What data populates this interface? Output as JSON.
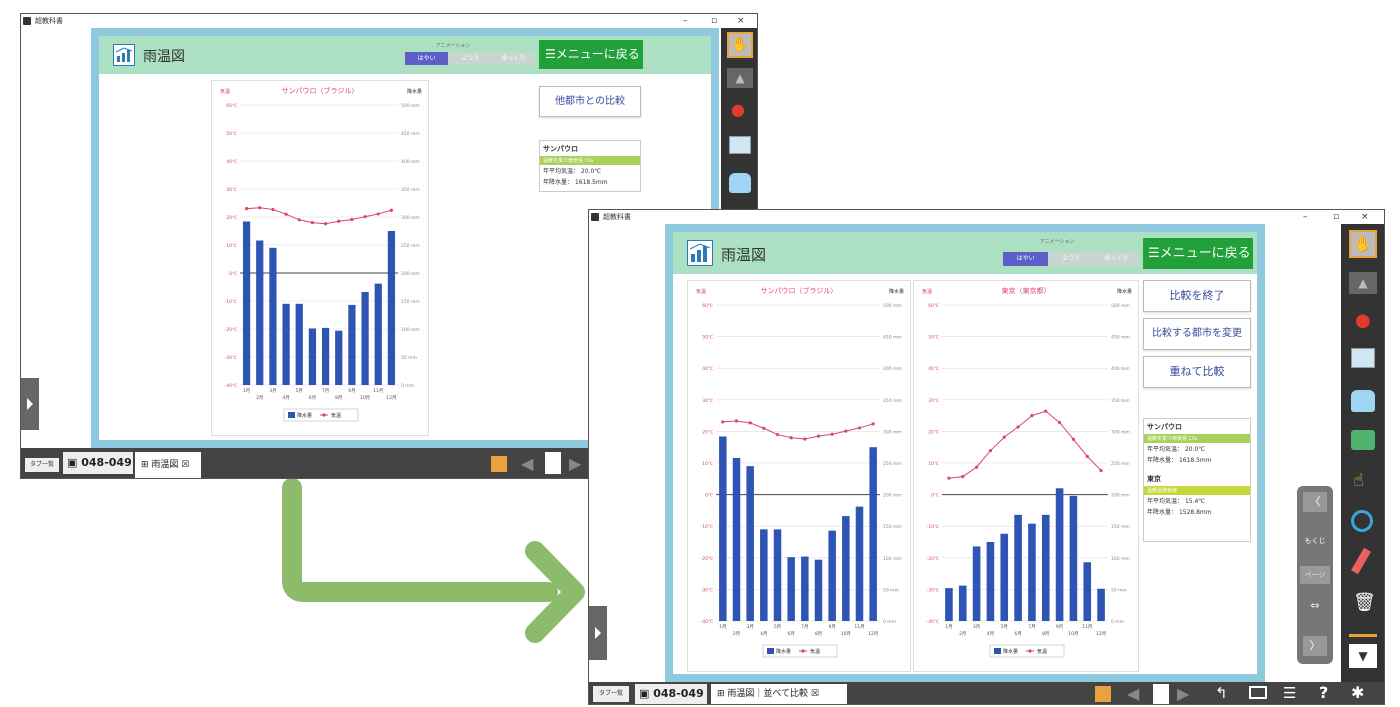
{
  "app_title": "超教科書",
  "window_controls": {
    "min": "–",
    "max": "▫",
    "close": "×"
  },
  "accent": {
    "header": "#ace0c2",
    "menu": "#22a03a",
    "stage": "#8ec9df",
    "bar": "#2e55b4",
    "temp": "#d6476a",
    "speed_on": "#5b5fc7"
  },
  "header": {
    "title": "雨温図",
    "animation_label": "アニメーション",
    "speeds": [
      "はやい",
      "ふつう",
      "ゆっくり"
    ],
    "menu_label": "メニューに戻る"
  },
  "before": {
    "compare_button": "他都市との比較",
    "tab_list": "タブ一覧",
    "tab_pages": "048-049",
    "tab_current": "雨温図"
  },
  "after": {
    "buttons": [
      "比較を終了",
      "比較する都市を変更",
      "重ねて比較"
    ],
    "tab_list": "タブ一覧",
    "tab_pages": "048-049",
    "tab_current": "雨温図｜並べて比較",
    "nav": {
      "contents": "もくじ",
      "page": "ページ"
    }
  },
  "cities": [
    {
      "name": "サンパウロ",
      "climate": "温暖冬季少雨気候 Cfa",
      "avg_temp_label": "年平均気温：",
      "avg_temp": "20.0℃",
      "precip_label": "年降水量：",
      "precip": "1618.5mm"
    },
    {
      "name": "東京",
      "climate": "温暖湿潤気候",
      "avg_temp_label": "年平均気温：",
      "avg_temp": "15.4℃",
      "precip_label": "年降水量：",
      "precip": "1528.8mm"
    }
  ],
  "chart_data": [
    {
      "type": "bar",
      "title": "サンパウロ（ブラジル）",
      "left_label": "気温",
      "right_label": "降水量",
      "categories": [
        "1月",
        "2月",
        "3月",
        "4月",
        "5月",
        "6月",
        "7月",
        "8月",
        "9月",
        "10月",
        "11月",
        "12月"
      ],
      "temp_ticks": [
        "60℃",
        "50℃",
        "40℃",
        "30℃",
        "20℃",
        "10℃",
        "0℃",
        "-10℃",
        "-20℃",
        "-30℃",
        "-40℃"
      ],
      "precip_ticks": [
        "500 mm",
        "450 mm",
        "400 mm",
        "350 mm",
        "300 mm",
        "250 mm",
        "200 mm",
        "150 mm",
        "100 mm",
        "50 mm",
        "0 mm"
      ],
      "ylim_temp": [
        -40,
        60
      ],
      "ylim_precip": [
        0,
        500
      ],
      "series": [
        {
          "name": "降水量",
          "values": [
            292,
            258,
            245,
            145,
            145,
            101,
            102,
            97,
            143,
            166,
            181,
            275
          ]
        },
        {
          "name": "気温",
          "values": [
            23.0,
            23.3,
            22.7,
            21.0,
            19.0,
            18.0,
            17.6,
            18.5,
            19.1,
            20.1,
            21.1,
            22.4
          ]
        }
      ]
    },
    {
      "type": "bar",
      "title": "東京（東京都）",
      "left_label": "気温",
      "right_label": "降水量",
      "categories": [
        "1月",
        "2月",
        "3月",
        "4月",
        "5月",
        "6月",
        "7月",
        "8月",
        "9月",
        "10月",
        "11月",
        "12月"
      ],
      "temp_ticks": [
        "60℃",
        "50℃",
        "40℃",
        "30℃",
        "20℃",
        "10℃",
        "0℃",
        "-10℃",
        "-20℃",
        "-30℃",
        "-40℃"
      ],
      "precip_ticks": [
        "500 mm",
        "450 mm",
        "400 mm",
        "350 mm",
        "300 mm",
        "250 mm",
        "200 mm",
        "150 mm",
        "100 mm",
        "50 mm",
        "0 mm"
      ],
      "ylim_temp": [
        -40,
        60
      ],
      "ylim_precip": [
        0,
        500
      ],
      "series": [
        {
          "name": "降水量",
          "values": [
            52,
            56,
            118,
            125,
            138,
            168,
            154,
            168,
            210,
            198,
            93,
            51
          ]
        },
        {
          "name": "気温",
          "values": [
            5.2,
            5.7,
            8.7,
            13.9,
            18.2,
            21.4,
            25.0,
            26.4,
            22.8,
            17.5,
            12.1,
            7.6
          ]
        }
      ]
    }
  ]
}
